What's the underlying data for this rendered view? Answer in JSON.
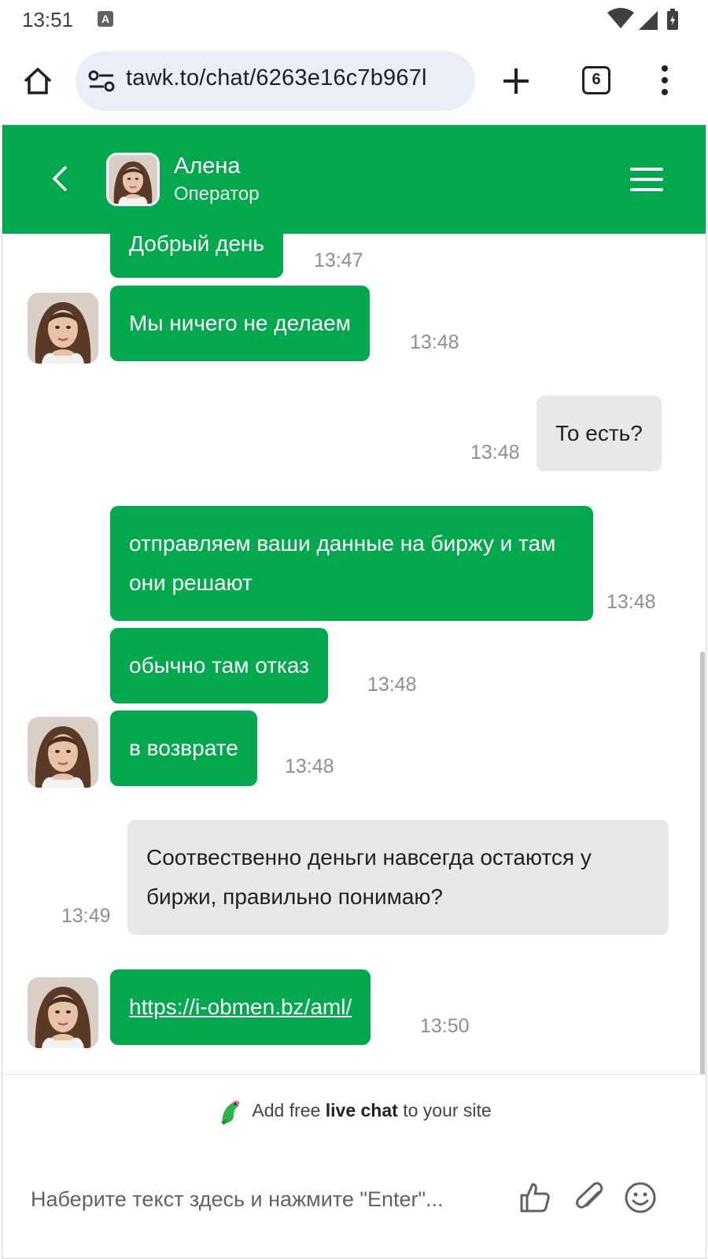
{
  "status_bar": {
    "time": "13:51",
    "notif_badge": "A"
  },
  "browser": {
    "url": "tawk.to/chat/6263e16c7b967l",
    "tab_count": "6"
  },
  "header": {
    "agent_name": "Алена",
    "agent_role": "Оператор"
  },
  "messages": [
    {
      "from": "agent",
      "text": "Добрый день",
      "time": "13:47"
    },
    {
      "from": "agent",
      "text": "Мы ничего не делаем",
      "time": "13:48"
    },
    {
      "from": "visitor",
      "text": "То есть?",
      "time": "13:48"
    },
    {
      "from": "agent",
      "text": "отправляем ваши данные на биржу и там они решают",
      "time": "13:48"
    },
    {
      "from": "agent",
      "text": "обычно там отказ",
      "time": "13:48"
    },
    {
      "from": "agent",
      "text": "в возврате",
      "time": "13:48"
    },
    {
      "from": "visitor",
      "text": "Соотвественно деньги навсегда остаются у биржи, правильно понимаю?",
      "time": "13:49"
    },
    {
      "from": "agent",
      "text": "https://i-obmen.bz/aml/",
      "time": "13:50"
    }
  ],
  "branding": {
    "prefix": "Add free",
    "bold": "live chat",
    "suffix": "to your site"
  },
  "composer": {
    "placeholder": "Наберите текст здесь и нажмите \"Enter\"..."
  },
  "colors": {
    "accent": "#03a84e",
    "visitor_bubble": "#e8e8e8",
    "timestamp": "#8a8f96"
  }
}
